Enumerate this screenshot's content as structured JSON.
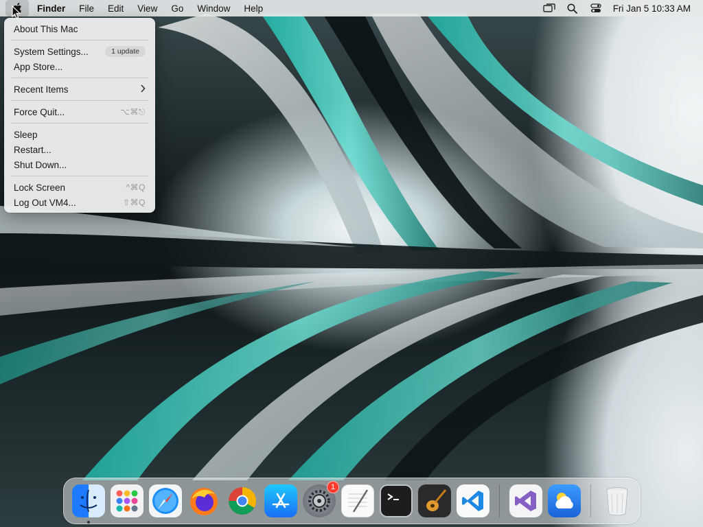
{
  "menubar": {
    "app_name": "Finder",
    "items": [
      "File",
      "Edit",
      "View",
      "Go",
      "Window",
      "Help"
    ],
    "clock": "Fri Jan 5  10:33 AM"
  },
  "apple_menu": {
    "about": "About This Mac",
    "system_settings": "System Settings...",
    "system_settings_badge": "1 update",
    "app_store": "App Store...",
    "recent_items": "Recent Items",
    "force_quit": "Force Quit...",
    "force_quit_shortcut": "⌥⌘⎋",
    "sleep": "Sleep",
    "restart": "Restart...",
    "shut_down": "Shut Down...",
    "lock_screen": "Lock Screen",
    "lock_screen_shortcut": "^⌘Q",
    "log_out": "Log Out VM4...",
    "log_out_shortcut": "⇧⌘Q"
  },
  "dock": {
    "settings_badge": "1",
    "apps": [
      "finder-icon",
      "launchpad-icon",
      "safari-icon",
      "firefox-icon",
      "chrome-icon",
      "app-store-icon",
      "system-settings-icon",
      "textedit-icon",
      "terminal-icon",
      "garageband-icon",
      "vscode-icon",
      "visual-studio-icon",
      "weather-icon",
      "trash-icon"
    ]
  },
  "colors": {
    "menu_bg": "#ecedee",
    "badge_red": "#ff3b30",
    "wallpaper_teal": "#2fd0c0"
  }
}
